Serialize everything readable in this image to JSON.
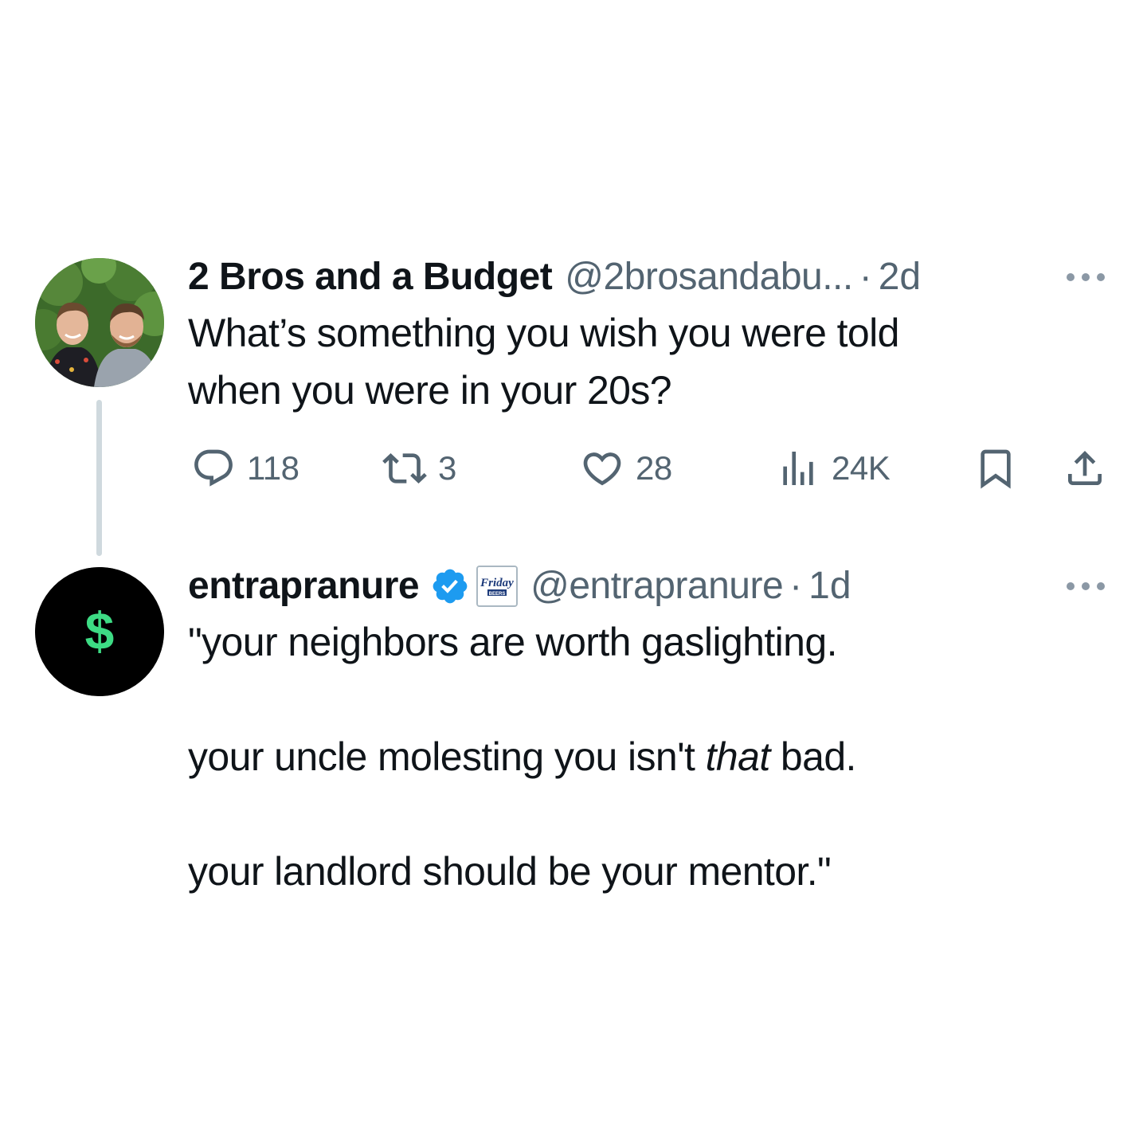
{
  "tweets": [
    {
      "display_name": "2 Bros and a Budget",
      "handle": "@2brosandabu...",
      "separator": "·",
      "time": "2d",
      "text_lines": [
        "What’s something you wish you were told",
        "when you were in your 20s?"
      ],
      "avatar": "photo-avatar",
      "actions": {
        "replies": "118",
        "retweets": "3",
        "likes": "28",
        "views": "24K"
      },
      "icons": [
        "reply-icon",
        "retweet-icon",
        "like-icon",
        "views-icon",
        "bookmark-icon",
        "share-icon",
        "more-icon"
      ]
    },
    {
      "display_name": "entrapranure",
      "handle": "@entrapranure",
      "separator": "·",
      "time": "1d",
      "verified": true,
      "affiliation_badge": "Friday Beers",
      "avatar": "dollar-sign-avatar",
      "avatar_symbol": "$",
      "paragraphs": {
        "p1": "\"your neighbors are worth gaslighting.",
        "p2_pre": "your uncle molesting you isn't ",
        "p2_em": "that",
        "p2_post": " bad.",
        "p3": "your landlord should be your mentor.\""
      },
      "icons": [
        "verified-badge-icon",
        "more-icon"
      ]
    }
  ],
  "colors": {
    "text_primary": "#0f1419",
    "text_secondary": "#536471",
    "verified_blue": "#1d9bf0",
    "thread_line": "#cfd9de",
    "dollar_green": "#3ddc84"
  }
}
